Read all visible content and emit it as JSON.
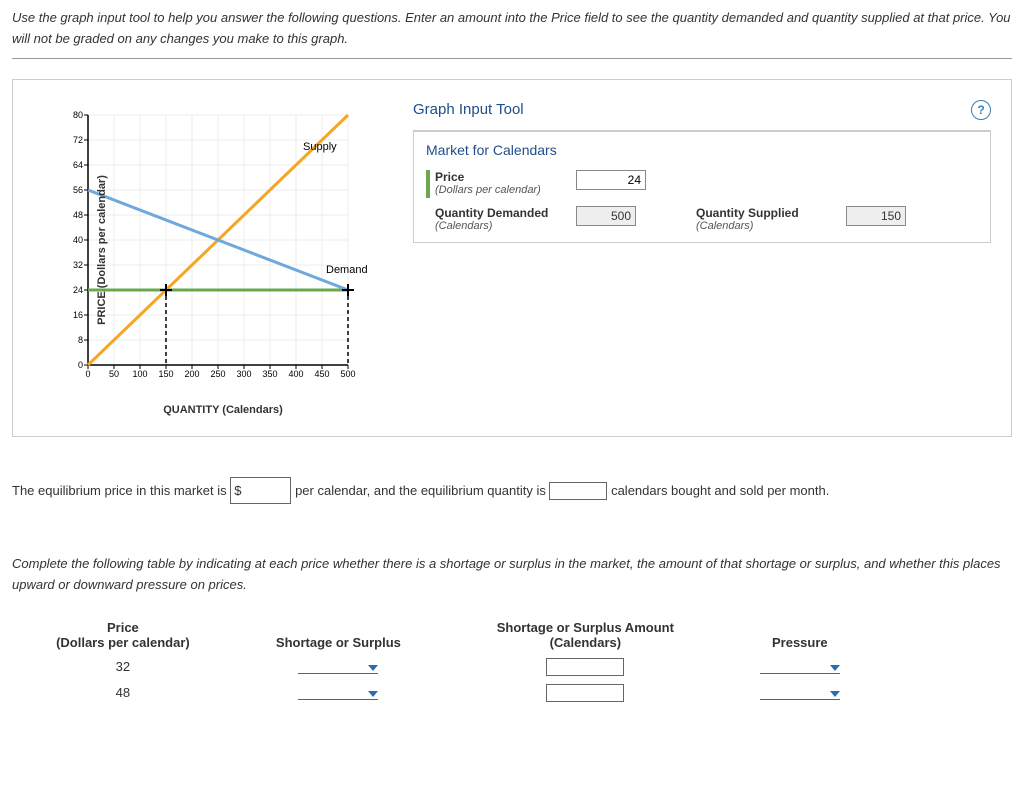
{
  "intro": "Use the graph input tool to help you answer the following questions. Enter an amount into the Price field to see the quantity demanded and quantity supplied at that price. You will not be graded on any changes you make to this graph.",
  "tool": {
    "title": "Graph Input Tool",
    "market_title": "Market for Calendars",
    "price_label": "Price",
    "price_sub": "(Dollars per calendar)",
    "price_value": "24",
    "qd_label": "Quantity Demanded",
    "qd_sub": "(Calendars)",
    "qd_value": "500",
    "qs_label": "Quantity Supplied",
    "qs_sub": "(Calendars)",
    "qs_value": "150"
  },
  "chart_data": {
    "type": "line",
    "title": "",
    "xlabel": "QUANTITY (Calendars)",
    "ylabel": "PRICE (Dollars per calendar)",
    "xlim": [
      0,
      500
    ],
    "ylim": [
      0,
      80
    ],
    "xticks": [
      0,
      50,
      100,
      150,
      200,
      250,
      300,
      350,
      400,
      450,
      500
    ],
    "yticks": [
      0,
      8,
      16,
      24,
      32,
      40,
      48,
      56,
      64,
      72,
      80
    ],
    "series": [
      {
        "name": "Supply",
        "color": "#f5a623",
        "points": [
          [
            0,
            0
          ],
          [
            500,
            80
          ]
        ]
      },
      {
        "name": "Demand",
        "color": "#6fa8dc",
        "points": [
          [
            0,
            56
          ],
          [
            500,
            24
          ]
        ]
      },
      {
        "name": "PriceLine",
        "color": "#6aa84f",
        "points": [
          [
            0,
            24
          ],
          [
            500,
            24
          ]
        ]
      }
    ],
    "markers": [
      {
        "x": 150,
        "y": 24,
        "style": "plus-dashed"
      },
      {
        "x": 500,
        "y": 24,
        "style": "plus-dashed"
      }
    ],
    "legend_labels": {
      "supply": "Supply",
      "demand": "Demand"
    }
  },
  "q1": {
    "pre": "The equilibrium price in this market is ",
    "prefix": "$",
    "mid": " per calendar, and the equilibrium quantity is ",
    "post": " calendars bought and sold per month."
  },
  "q2": {
    "intro": "Complete the following table by indicating at each price whether there is a shortage or surplus in the market, the amount of that shortage or surplus, and whether this places upward or downward pressure on prices.",
    "headers": {
      "price": "Price",
      "price_sub": "(Dollars per calendar)",
      "ss": "Shortage or Surplus",
      "amount": "Shortage or Surplus Amount",
      "amount_sub": "(Calendars)",
      "pressure": "Pressure"
    },
    "rows": [
      {
        "price": "32"
      },
      {
        "price": "48"
      }
    ]
  }
}
